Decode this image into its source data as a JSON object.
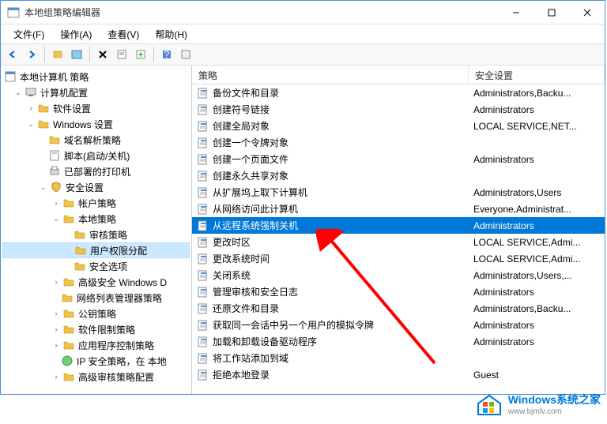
{
  "window": {
    "title": "本地组策略编辑器"
  },
  "menu": {
    "file": "文件(F)",
    "action": "操作(A)",
    "view": "查看(V)",
    "help": "帮助(H)"
  },
  "tree": {
    "root": "本地计算机 策略",
    "computer": "计算机配置",
    "software": "软件设置",
    "windows": "Windows 设置",
    "dns": "域名解析策略",
    "scripts": "脚本(启动/关机)",
    "printers": "已部署的打印机",
    "security": "安全设置",
    "account": "帐户策略",
    "local": "本地策略",
    "audit": "审核策略",
    "rights": "用户权限分配",
    "options": "安全选项",
    "defender": "高级安全 Windows D",
    "netlist": "网络列表管理器策略",
    "pubkey": "公钥策略",
    "softrestrict": "软件限制策略",
    "appctrl": "应用程序控制策略",
    "ipsec": "IP 安全策略，在 本地",
    "advaudit": "高级审核策略配置"
  },
  "columns": {
    "policy": "策略",
    "security": "安全设置"
  },
  "policies": [
    {
      "name": "备份文件和目录",
      "setting": "Administrators,Backu..."
    },
    {
      "name": "创建符号链接",
      "setting": "Administrators"
    },
    {
      "name": "创建全局对象",
      "setting": "LOCAL SERVICE,NET..."
    },
    {
      "name": "创建一个令牌对象",
      "setting": ""
    },
    {
      "name": "创建一个页面文件",
      "setting": "Administrators"
    },
    {
      "name": "创建永久共享对象",
      "setting": ""
    },
    {
      "name": "从扩展坞上取下计算机",
      "setting": "Administrators,Users"
    },
    {
      "name": "从网络访问此计算机",
      "setting": "Everyone,Administrat..."
    },
    {
      "name": "从远程系统强制关机",
      "setting": "Administrators",
      "selected": true
    },
    {
      "name": "更改时区",
      "setting": "LOCAL SERVICE,Admi..."
    },
    {
      "name": "更改系统时间",
      "setting": "LOCAL SERVICE,Admi..."
    },
    {
      "name": "关闭系统",
      "setting": "Administrators,Users,..."
    },
    {
      "name": "管理审核和安全日志",
      "setting": "Administrators"
    },
    {
      "name": "还原文件和目录",
      "setting": "Administrators,Backu..."
    },
    {
      "name": "获取同一会话中另一个用户的模拟令牌",
      "setting": "Administrators"
    },
    {
      "name": "加载和卸载设备驱动程序",
      "setting": "Administrators"
    },
    {
      "name": "将工作站添加到域",
      "setting": ""
    },
    {
      "name": "拒绝本地登录",
      "setting": "Guest"
    }
  ],
  "watermark": {
    "t1": "Windows系统之家",
    "t2": "www.bjmlv.com"
  }
}
